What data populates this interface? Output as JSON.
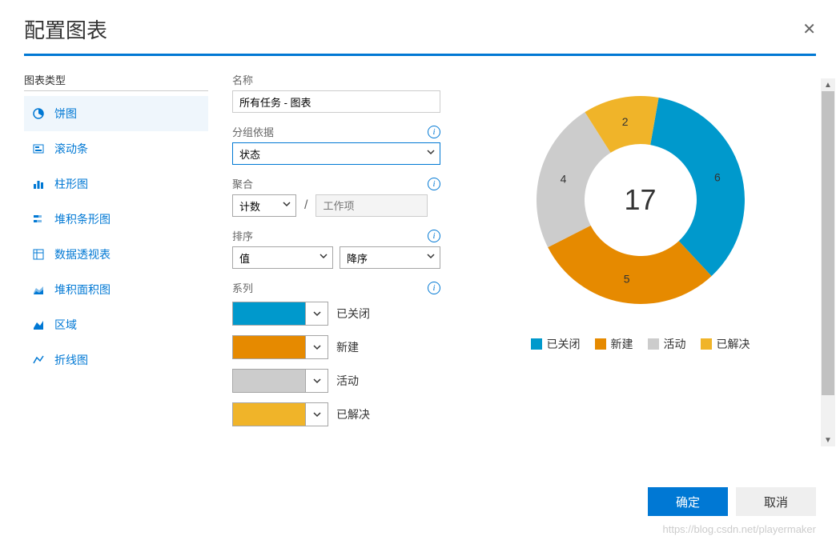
{
  "header": {
    "title": "配置图表"
  },
  "left": {
    "section_label": "图表类型",
    "items": [
      {
        "label": "饼图"
      },
      {
        "label": "滚动条"
      },
      {
        "label": "柱形图"
      },
      {
        "label": "堆积条形图"
      },
      {
        "label": "数据透视表"
      },
      {
        "label": "堆积面积图"
      },
      {
        "label": "区域"
      },
      {
        "label": "折线图"
      }
    ]
  },
  "mid": {
    "name_label": "名称",
    "name_value": "所有任务 - 图表",
    "group_label": "分组依据",
    "group_value": "状态",
    "agg_label": "聚合",
    "agg_value": "计数",
    "agg_of_placeholder": "工作项",
    "sort_label": "排序",
    "sort_by_value": "值",
    "sort_dir_value": "降序",
    "series_label": "系列",
    "series": [
      {
        "label": "已关闭",
        "color": "#0099cc"
      },
      {
        "label": "新建",
        "color": "#e68a00"
      },
      {
        "label": "活动",
        "color": "#cccccc"
      },
      {
        "label": "已解决",
        "color": "#f0b429"
      }
    ]
  },
  "chart_data": {
    "type": "pie",
    "total_label": "17",
    "slices": [
      {
        "name": "已关闭",
        "value": 6,
        "color": "#0099cc"
      },
      {
        "name": "新建",
        "value": 5,
        "color": "#e68a00"
      },
      {
        "name": "活动",
        "value": 4,
        "color": "#cccccc"
      },
      {
        "name": "已解决",
        "value": 2,
        "color": "#f0b429"
      }
    ],
    "legend": [
      {
        "name": "已关闭",
        "color": "#0099cc"
      },
      {
        "name": "新建",
        "color": "#e68a00"
      },
      {
        "name": "活动",
        "color": "#cccccc"
      },
      {
        "name": "已解决",
        "color": "#f0b429"
      }
    ]
  },
  "footer": {
    "ok": "确定",
    "cancel": "取消"
  },
  "watermark": "https://blog.csdn.net/playermaker"
}
